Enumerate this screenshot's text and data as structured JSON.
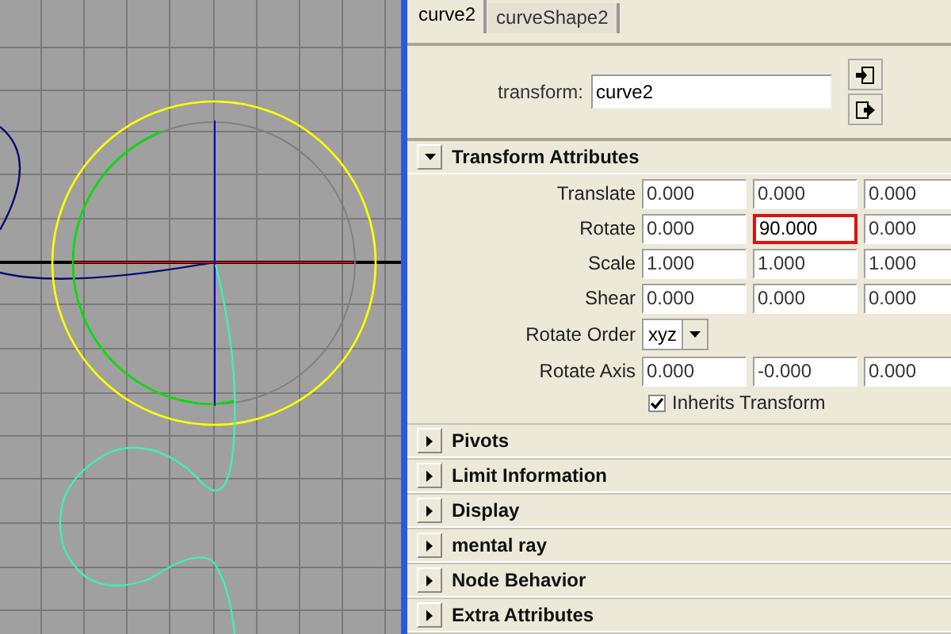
{
  "tabs": [
    {
      "label": "curve2",
      "selected": true
    },
    {
      "label": "curveShape2",
      "selected": false
    }
  ],
  "node": {
    "label": "transform:",
    "value": "curve2"
  },
  "sections": [
    {
      "title": "Transform Attributes",
      "expanded": true,
      "rows": [
        {
          "kind": "vector",
          "label": "Translate",
          "fields": [
            {
              "value": "0.000",
              "highlighted": false
            },
            {
              "value": "0.000",
              "highlighted": false
            },
            {
              "value": "0.000",
              "highlighted": false
            }
          ]
        },
        {
          "kind": "vector",
          "label": "Rotate",
          "fields": [
            {
              "value": "0.000",
              "highlighted": false
            },
            {
              "value": "90.000",
              "highlighted": true
            },
            {
              "value": "0.000",
              "highlighted": false
            }
          ]
        },
        {
          "kind": "vector",
          "label": "Scale",
          "fields": [
            {
              "value": "1.000",
              "highlighted": false
            },
            {
              "value": "1.000",
              "highlighted": false
            },
            {
              "value": "1.000",
              "highlighted": false
            }
          ]
        },
        {
          "kind": "vector",
          "label": "Shear",
          "fields": [
            {
              "value": "0.000",
              "highlighted": false
            },
            {
              "value": "0.000",
              "highlighted": false
            },
            {
              "value": "0.000",
              "highlighted": false
            }
          ]
        },
        {
          "kind": "enum",
          "label": "Rotate Order",
          "value": "xyz"
        },
        {
          "kind": "vector",
          "label": "Rotate Axis",
          "fields": [
            {
              "value": "0.000",
              "highlighted": false
            },
            {
              "value": "-0.000",
              "highlighted": false
            },
            {
              "value": "0.000",
              "highlighted": false
            }
          ]
        },
        {
          "kind": "checkbox",
          "label": "Inherits Transform",
          "checked": true
        }
      ]
    },
    {
      "title": "Pivots",
      "expanded": false
    },
    {
      "title": "Limit Information",
      "expanded": false
    },
    {
      "title": "Display",
      "expanded": false
    },
    {
      "title": "mental ray",
      "expanded": false
    },
    {
      "title": "Node Behavior",
      "expanded": false
    },
    {
      "title": "Extra Attributes",
      "expanded": false
    }
  ]
}
